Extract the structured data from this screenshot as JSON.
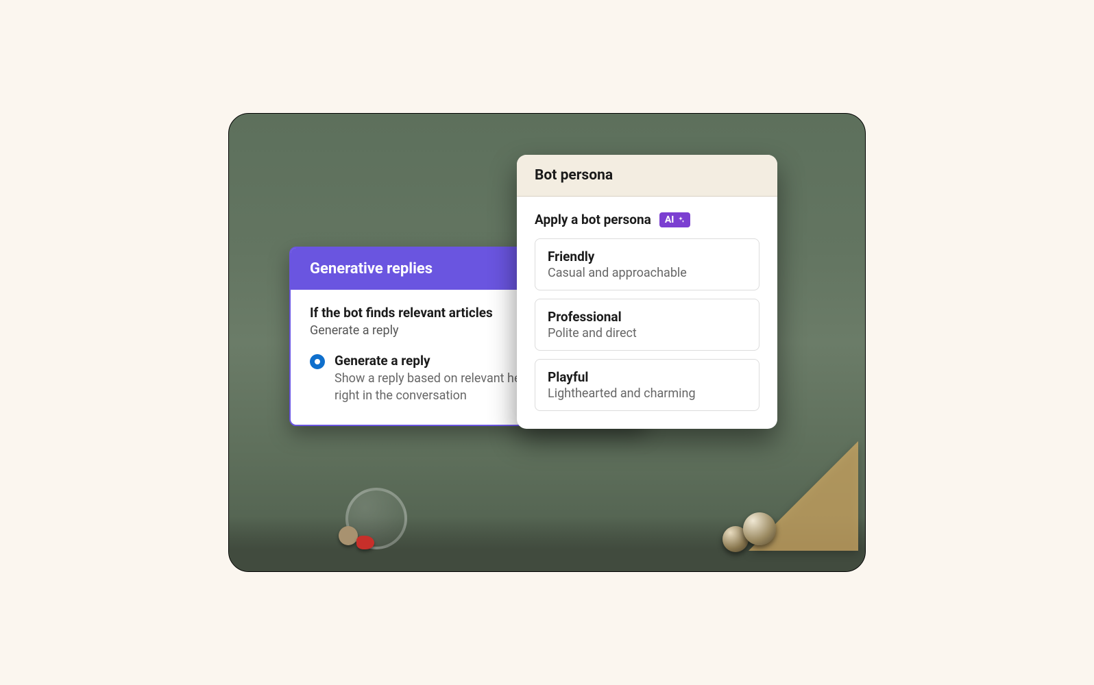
{
  "back_card": {
    "title": "Generative replies",
    "section_title": "If the bot finds relevant articles",
    "section_sub": "Generate a reply",
    "option": {
      "title": "Generate a reply",
      "desc": "Show a reply based on relevant help center content right in the conversation"
    }
  },
  "front_card": {
    "title": "Bot persona",
    "apply_label": "Apply a bot persona",
    "ai_badge": "AI",
    "personas": [
      {
        "title": "Friendly",
        "desc": "Casual and approachable"
      },
      {
        "title": "Professional",
        "desc": "Polite and direct"
      },
      {
        "title": "Playful",
        "desc": "Lighthearted and charming"
      }
    ]
  }
}
